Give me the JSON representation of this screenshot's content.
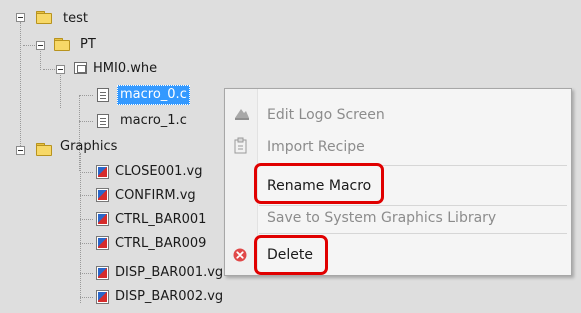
{
  "tree": {
    "root": {
      "label": "test"
    },
    "pt": {
      "label": "PT"
    },
    "hmi": {
      "label": "HMI0.whe"
    },
    "macro0": {
      "label": "macro_0.c"
    },
    "macro1": {
      "label": "macro_1.c"
    },
    "graphics": {
      "label": "Graphics"
    },
    "files": [
      "CLOSE001.vg",
      "CONFIRM.vg",
      "CTRL_BAR001",
      "CTRL_BAR009",
      "DISP_BAR001.vg",
      "DISP_BAR002.vg"
    ]
  },
  "context_menu": {
    "items": [
      {
        "label": "Edit Logo Screen",
        "enabled": false,
        "icon": "edit-logo-icon"
      },
      {
        "label": "Import Recipe",
        "enabled": false,
        "icon": "import-recipe-icon"
      },
      {
        "label": "Rename Macro",
        "enabled": true,
        "highlighted": true
      },
      {
        "label": "Save to System Graphics Library",
        "enabled": false
      },
      {
        "label": "Delete",
        "enabled": true,
        "highlighted": true,
        "icon": "delete-icon"
      }
    ]
  },
  "colors": {
    "highlight": "#e00000",
    "selection": "#3399ff",
    "tree_bg": "#dedede"
  }
}
